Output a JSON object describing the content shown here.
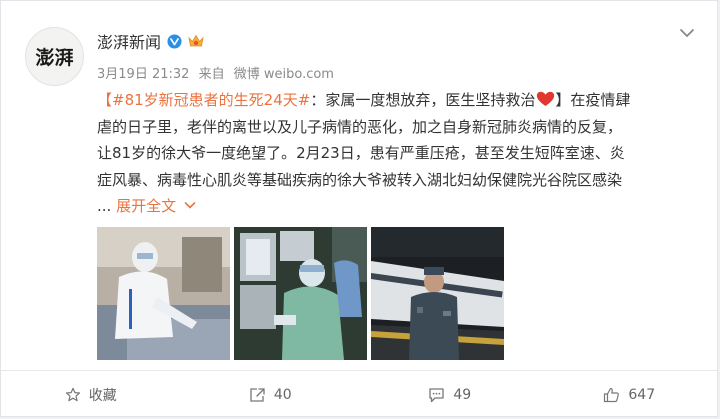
{
  "post": {
    "author": "澎湃新闻",
    "avatar_text": "澎湃",
    "meta": {
      "date": "3月19日 21:32",
      "source_prefix": "来自",
      "source": "微博 weibo.com"
    },
    "topic": "【#81岁新冠患者的生死24天#",
    "text_line1_rest": "：家属一度想放弃，医生坚持救治",
    "text_line1_tail": "】在疫情肆",
    "text_line2": "虐的日子里，老伴的离世以及儿子病情的恶化，加之自身新冠肺炎病情的反复，",
    "text_line3": "让81岁的徐大爷一度绝望了。2月23日，患有严重压疮，甚至发生短阵室速、炎",
    "text_line4": "症风暴、病毒性心肌炎等基础疾病的徐大爷被转入湖北妇幼保健院光谷院区感染",
    "ellipsis": "...",
    "expand_label": "展开全文",
    "images": [
      "medical-worker-at-bedside",
      "doctors-reviewing-xray",
      "patient-on-train-platform"
    ]
  },
  "actions": {
    "favorite_label": "收藏",
    "repost_count": "40",
    "comment_count": "49",
    "like_count": "647"
  },
  "colors": {
    "accent": "#eb7340",
    "text": "#333333",
    "meta": "#8a8a8a",
    "verified": "#2b8fe8",
    "heart": "#e0372f"
  }
}
